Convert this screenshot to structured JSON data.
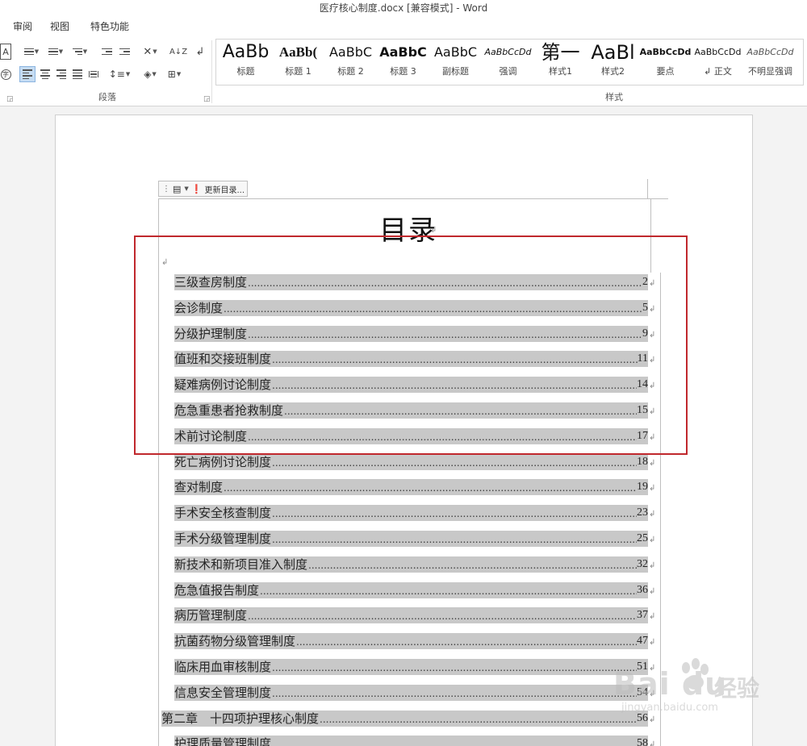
{
  "window": {
    "title": "医疗核心制度.docx [兼容模式] - Word"
  },
  "ribbon_tabs": [
    "审阅",
    "视图",
    "特色功能"
  ],
  "ribbon": {
    "groups": {
      "paragraph": "段落",
      "styles": "样式"
    },
    "styles": [
      {
        "preview": "AaBb",
        "name": "标题"
      },
      {
        "preview": "AaBb(",
        "name": "标题 1"
      },
      {
        "preview": "AaBbC",
        "name": "标题 2"
      },
      {
        "preview": "AaBbC",
        "name": "标题 3"
      },
      {
        "preview": "AaBbC",
        "name": "副标题"
      },
      {
        "preview": "AaBbCcDd",
        "name": "强调"
      },
      {
        "preview": "第一",
        "name": "样式1"
      },
      {
        "preview": "AaBl",
        "name": "样式2"
      },
      {
        "preview": "AaBbCcDd",
        "name": "要点"
      },
      {
        "preview": "AaBbCcDd",
        "name": "↲ 正文"
      },
      {
        "preview": "AaBbCcDd",
        "name": "不明显强调"
      }
    ],
    "icons": {
      "char_border": "A",
      "sort": "A↓Z",
      "show_marks": "↲"
    }
  },
  "document": {
    "toc_toolbar": {
      "update_label": "更新目录..."
    },
    "toc_title": "目录",
    "paragraph_mark": "↲",
    "entries": [
      {
        "text": "三级查房制度",
        "page": "2"
      },
      {
        "text": "会诊制度",
        "page": "5"
      },
      {
        "text": "分级护理制度",
        "page": "9"
      },
      {
        "text": "值班和交接班制度",
        "page": "11"
      },
      {
        "text": "疑难病例讨论制度",
        "page": "14"
      },
      {
        "text": "危急重患者抢救制度",
        "page": "15"
      },
      {
        "text": "术前讨论制度",
        "page": "17"
      },
      {
        "text": "死亡病例讨论制度",
        "page": "18"
      },
      {
        "text": "查对制度",
        "page": "19"
      },
      {
        "text": "手术安全核查制度",
        "page": "23"
      },
      {
        "text": "手术分级管理制度",
        "page": "25"
      },
      {
        "text": "新技术和新项目准入制度",
        "page": "32"
      },
      {
        "text": "危急值报告制度",
        "page": "36"
      },
      {
        "text": "病历管理制度",
        "page": "37"
      },
      {
        "text": "抗菌药物分级管理制度",
        "page": "47"
      },
      {
        "text": "临床用血审核制度",
        "page": "51"
      },
      {
        "text": "信息安全管理制度",
        "page": "54"
      },
      {
        "text": "第二章　十四项护理核心制度",
        "page": "56"
      },
      {
        "text": "护理质量管理制度",
        "page": "58"
      }
    ]
  },
  "watermark": {
    "logo": "Bai du",
    "brand_cn": "经验",
    "url": "jingyan.baidu.com"
  },
  "colors": {
    "highlight_border": "#c0282d",
    "field_shading": "#c8c8c8",
    "active_button": "#c5dcf3"
  }
}
